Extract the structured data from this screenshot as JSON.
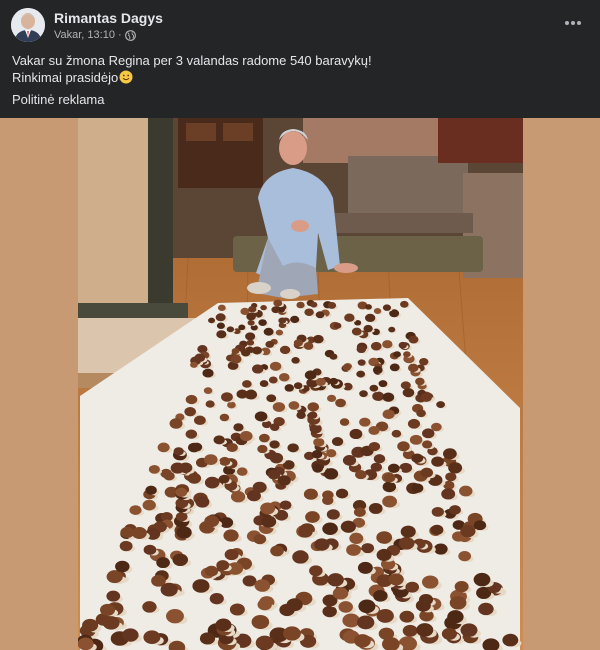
{
  "post": {
    "author": "Rimantas Dagys",
    "time": "Vakar, 13:10",
    "separator": "·",
    "text_line1": "Vakar su žmona Regina per 3 valandas radome 540 baravykų!",
    "text_line2": "Rinkimai prasidėjo",
    "sponsor_label": "Politinė reklama",
    "audience_icon": "globe-icon",
    "menu_icon": "more-horizontal-icon",
    "emoji": "slightly-smiling-face"
  },
  "colors": {
    "background": "#242526",
    "text_primary": "#e4e6eb",
    "text_secondary": "#b0b3b8",
    "photo_border": "#c79a73"
  }
}
